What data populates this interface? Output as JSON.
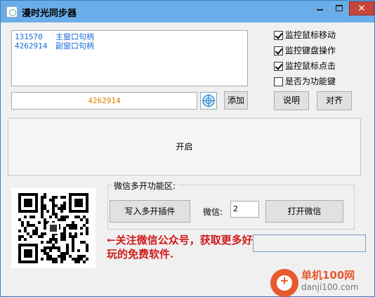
{
  "window": {
    "title": "漫时光同步器",
    "minimize_label": "",
    "maximize_label": "",
    "close_label": "✕"
  },
  "handles_list": [
    {
      "id": "131570",
      "label": "主窗口句柄"
    },
    {
      "id": "4262914",
      "label": "副窗口句柄"
    }
  ],
  "options": [
    {
      "label": "监控鼠标移动",
      "checked": true
    },
    {
      "label": "监控键盘操作",
      "checked": true
    },
    {
      "label": "监控鼠标点击",
      "checked": true
    },
    {
      "label": "是否为功能键",
      "checked": false
    }
  ],
  "handle_input": {
    "value": "4262914"
  },
  "buttons": {
    "add": "添加",
    "help": "说明",
    "align": "对齐",
    "start": "开启",
    "write_plugin": "写入多开插件",
    "open_wechat": "打开微信"
  },
  "wechat_group": {
    "title": "微信多开功能区:",
    "count_label": "微信:",
    "count_value": "2"
  },
  "promo_text": "←关注微信公众号，获取更多好玩的免费软件.",
  "watermark": {
    "name": "单机100网",
    "url": "danji100.com"
  },
  "icons": {
    "app": "app-icon",
    "crosshair": "crosshair-icon",
    "qr": "qr-code-image"
  },
  "colors": {
    "titlebar": "#6aaee9",
    "close": "#c7463a",
    "list_text": "#1a6bd6",
    "input_text": "#e07b00",
    "promo": "#d01a1a"
  }
}
